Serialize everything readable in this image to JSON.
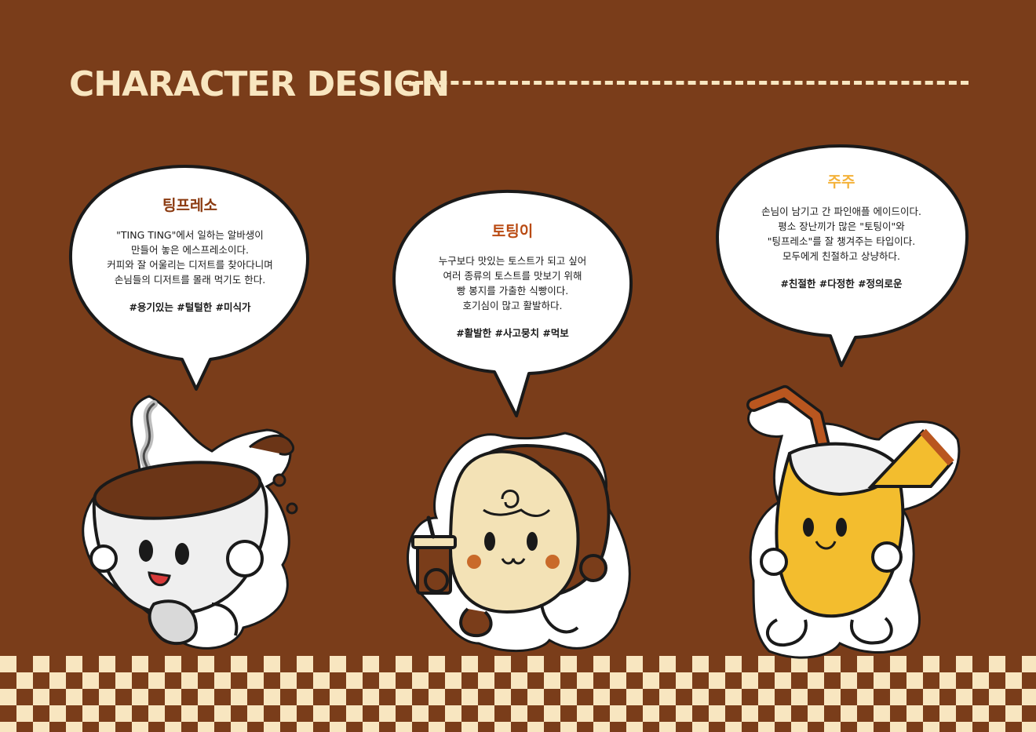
{
  "page": {
    "title": "CHARACTER DESIGN"
  },
  "colors": {
    "background": "#7a3d1a",
    "cream": "#f8e6c0",
    "tingpresso": "#8b3a10",
    "toting": "#b94a12",
    "juju": "#f4b23a"
  },
  "characters": [
    {
      "name": "팅프레소",
      "description": "\"TING TING\"에서 일하는 알바생이\n만들어 놓은 에스프레소이다.\n커피와 잘 어울리는 디저트를 찾아다니며\n손님들의 디저트를 몰래 먹기도 한다.",
      "tags": "#용기있는 #털털한 #미식가",
      "icon": "coffee-cup-character"
    },
    {
      "name": "토팅이",
      "description": "누구보다 맛있는 토스트가 되고 싶어\n여러 종류의 토스트를 맛보기 위해\n빵 봉지를 가출한 식빵이다.\n호기심이 많고 활발하다.",
      "tags": "#활발한 #사고뭉치 #먹보",
      "icon": "bread-toast-character"
    },
    {
      "name": "주주",
      "description": "손님이 남기고 간 파인애플 에이드이다.\n평소 장난끼가 많은 \"토팅이\"와\n\"팅프레소\"를 잘 챙겨주는 타입이다.\n모두에게 친절하고 상냥하다.",
      "tags": "#친절한 #다정한 #정의로운",
      "icon": "pineapple-ade-character"
    }
  ]
}
